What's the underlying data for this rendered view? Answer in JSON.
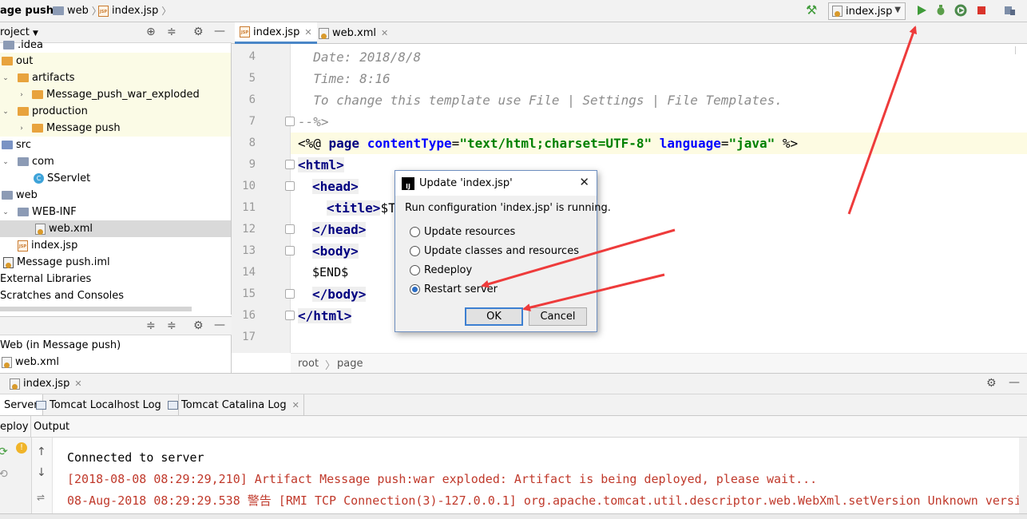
{
  "navbar": {
    "breadcrumbs": [
      "age push",
      "web",
      "index.jsp"
    ],
    "run_config": "index.jsp"
  },
  "project_panel": {
    "title": "roject",
    "tree": [
      {
        "label": ".idea",
        "icon": "folder-icon"
      },
      {
        "label": "out",
        "icon": "folder-orange-icon"
      },
      {
        "label": "artifacts",
        "icon": "folder-orange-icon"
      },
      {
        "label": "Message_push_war_exploded",
        "icon": "folder-orange-icon"
      },
      {
        "label": "production",
        "icon": "folder-orange-icon"
      },
      {
        "label": "Message push",
        "icon": "folder-orange-icon"
      },
      {
        "label": "src",
        "icon": "folder-blue-icon"
      },
      {
        "label": "com",
        "icon": "package-icon"
      },
      {
        "label": "SServlet",
        "icon": "class-icon"
      },
      {
        "label": "web",
        "icon": "folder-icon"
      },
      {
        "label": "WEB-INF",
        "icon": "folder-icon"
      },
      {
        "label": "web.xml",
        "icon": "xml-icon"
      },
      {
        "label": "index.jsp",
        "icon": "jsp-icon"
      },
      {
        "label": "Message push.iml",
        "icon": "iml-icon"
      },
      {
        "label": "External Libraries",
        "icon": "library-icon"
      },
      {
        "label": "Scratches and Consoles",
        "icon": "scratch-icon"
      }
    ]
  },
  "web_panel": {
    "items": [
      "Web (in Message push)",
      "web.xml"
    ]
  },
  "editor": {
    "tabs": [
      "index.jsp",
      "web.xml"
    ],
    "line_numbers": [
      "4",
      "5",
      "6",
      "7",
      "8",
      "9",
      "10",
      "11",
      "12",
      "13",
      "14",
      "15",
      "16",
      "17"
    ],
    "code": {
      "l4": "  Date: 2018/8/8",
      "l5": "  Time: 8:16",
      "l6": "  To change this template use File | Settings | File Templates.",
      "l7": "--%>",
      "l8_open": "<%@ ",
      "l8_page": "page ",
      "l8_attr1": "contentType",
      "l8_eq1": "=",
      "l8_val1": "\"text/html;charset=UTF-8\"",
      "l8_attr2": " language",
      "l8_eq2": "=",
      "l8_val2": "\"java\"",
      "l8_close": " %>",
      "l9": "<html>",
      "l10": "<head>",
      "l11_tag": "<title>",
      "l11_rest": "$T",
      "l12": "</head>",
      "l13": "<body>",
      "l14": "$END$",
      "l15": "</body>",
      "l16": "</html>"
    },
    "breadcrumb": [
      "root",
      "page"
    ]
  },
  "dialog": {
    "title": "Update 'index.jsp'",
    "message": "Run configuration 'index.jsp' is running.",
    "options": [
      {
        "label": "Update resources",
        "selected": false
      },
      {
        "label": "Update classes and resources",
        "selected": false
      },
      {
        "label": "Redeploy",
        "selected": false
      },
      {
        "label": "Restart server",
        "selected": true
      }
    ],
    "ok": "OK",
    "cancel": "Cancel"
  },
  "run_panel": {
    "title": "index.jsp",
    "tabs": [
      "Server",
      "Tomcat Localhost Log",
      "Tomcat Catalina Log"
    ],
    "sub_left": "eploy",
    "sub_right": "Output",
    "lines": [
      {
        "text": "Connected to server",
        "color": "#000000"
      },
      {
        "text": "[2018-08-08 08:29:29,210] Artifact Message push:war exploded: Artifact is being deployed, please wait...",
        "color": "#c0392b"
      },
      {
        "text": "08-Aug-2018 08:29:29.538 警告 [RMI TCP Connection(3)-127.0.0.1] org.apache.tomcat.util.descriptor.web.WebXml.setVersion Unknown versi",
        "color": "#c0392b"
      }
    ]
  },
  "colors": {
    "annotation_arrow": "#ee3b3b",
    "run_icon": "#3f9b39",
    "stop_icon": "#d9342b",
    "selection_blue": "#2d6ec4"
  }
}
